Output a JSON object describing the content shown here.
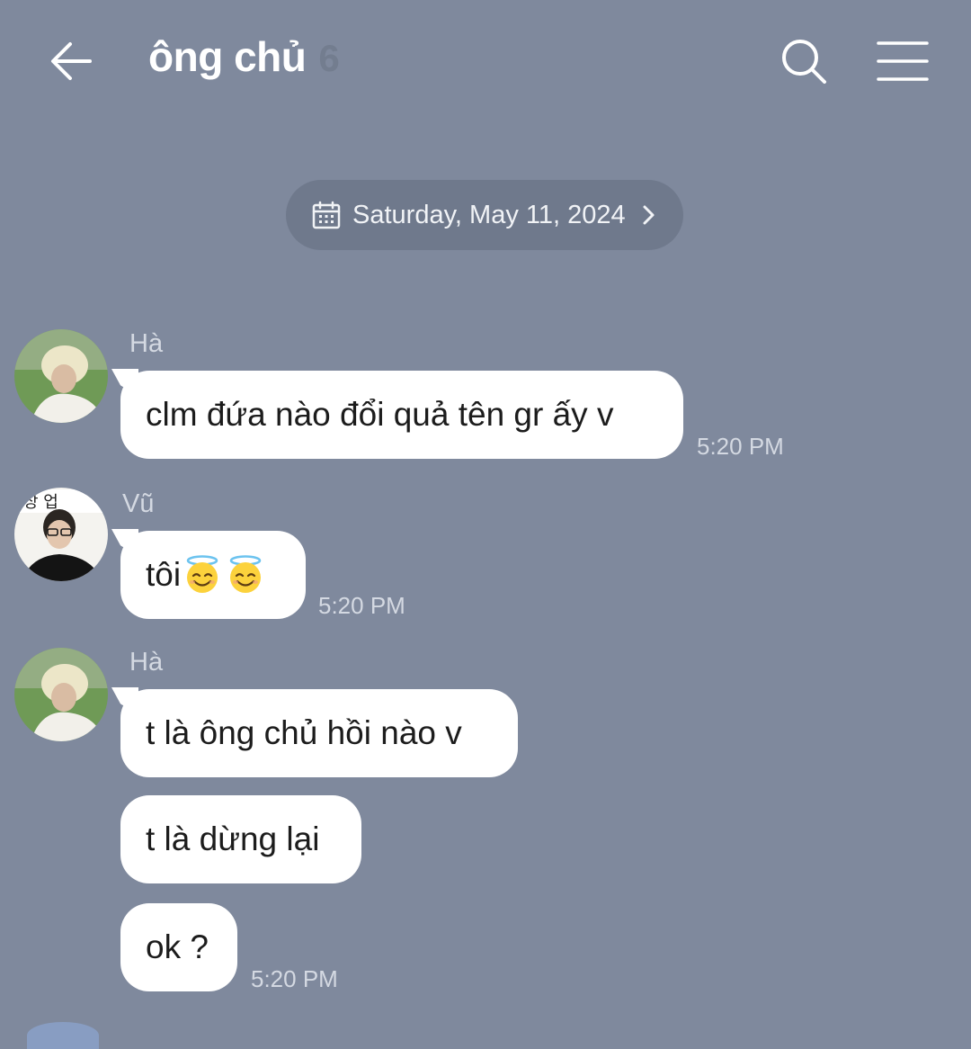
{
  "header": {
    "title": "ông chủ",
    "member_count": "6"
  },
  "date_divider": {
    "label": "Saturday, May 11, 2024"
  },
  "messages": [
    {
      "sender": "Hà",
      "text": "clm đứa nào đổi quả tên gr ấy v",
      "time": "5:20 PM"
    },
    {
      "sender": "Vũ",
      "text": "tôi",
      "emojis": [
        "smiling-face-with-halo-emoji",
        "smiling-face-with-halo-emoji"
      ],
      "time": "5:20 PM"
    },
    {
      "sender": "Hà",
      "text": "t là ông chủ hồi nào v"
    },
    {
      "text": "t là dừng lại"
    },
    {
      "text": "ok ?",
      "time": "5:20 PM"
    }
  ],
  "colors": {
    "background": "#7f899d",
    "bubble": "#ffffff",
    "date_pill": "#6f798c"
  }
}
